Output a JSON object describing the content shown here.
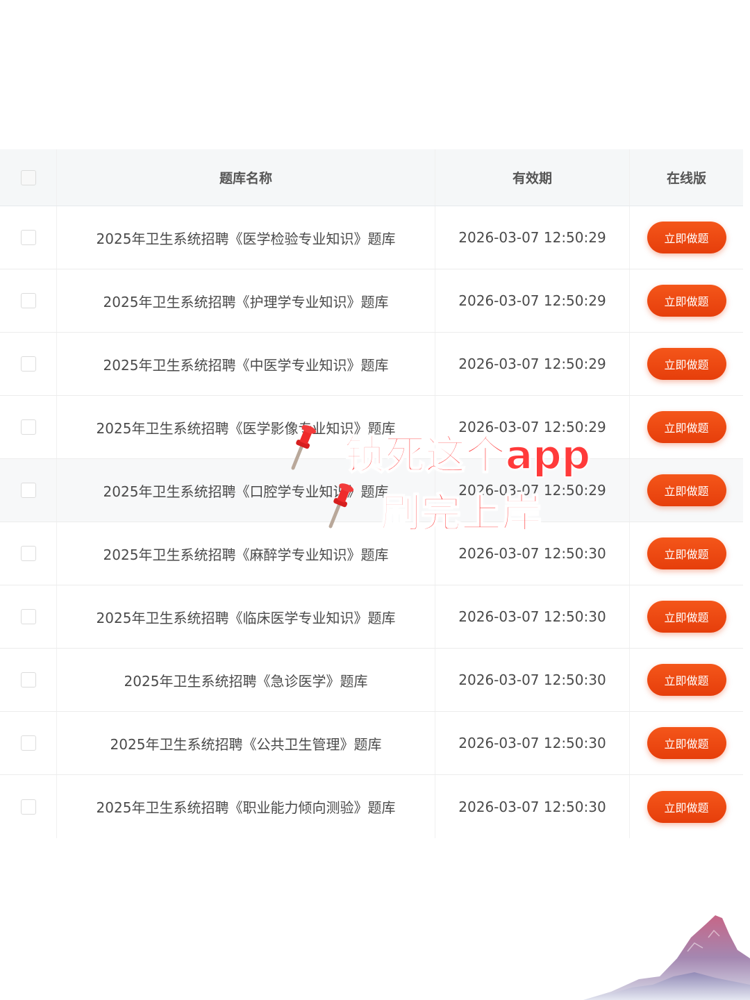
{
  "table": {
    "headers": {
      "name": "题库名称",
      "validity": "有效期",
      "online": "在线版"
    },
    "rows": [
      {
        "name": "2025年卫生系统招聘《医学检验专业知识》题库",
        "validity": "2026-03-07 12:50:29",
        "action": "立即做题"
      },
      {
        "name": "2025年卫生系统招聘《护理学专业知识》题库",
        "validity": "2026-03-07 12:50:29",
        "action": "立即做题"
      },
      {
        "name": "2025年卫生系统招聘《中医学专业知识》题库",
        "validity": "2026-03-07 12:50:29",
        "action": "立即做题"
      },
      {
        "name": "2025年卫生系统招聘《医学影像专业知识》题库",
        "validity": "2026-03-07 12:50:29",
        "action": "立即做题"
      },
      {
        "name": "2025年卫生系统招聘《口腔学专业知识》题库",
        "validity": "2026-03-07 12:50:29",
        "action": "立即做题"
      },
      {
        "name": "2025年卫生系统招聘《麻醉学专业知识》题库",
        "validity": "2026-03-07 12:50:30",
        "action": "立即做题"
      },
      {
        "name": "2025年卫生系统招聘《临床医学专业知识》题库",
        "validity": "2026-03-07 12:50:30",
        "action": "立即做题"
      },
      {
        "name": "2025年卫生系统招聘《急诊医学》题库",
        "validity": "2026-03-07 12:50:30",
        "action": "立即做题"
      },
      {
        "name": "2025年卫生系统招聘《公共卫生管理》题库",
        "validity": "2026-03-07 12:50:30",
        "action": "立即做题"
      },
      {
        "name": "2025年卫生系统招聘《职业能力倾向测验》题库",
        "validity": "2026-03-07 12:50:30",
        "action": "立即做题"
      }
    ]
  },
  "overlay": {
    "line1": "锁死这个app",
    "line2": "刷完上岸",
    "icon": "pushpin-icon"
  },
  "colors": {
    "button": "#e94a12",
    "overlay_text": "#ff3a3a",
    "header_bg": "#f5f7f8"
  }
}
